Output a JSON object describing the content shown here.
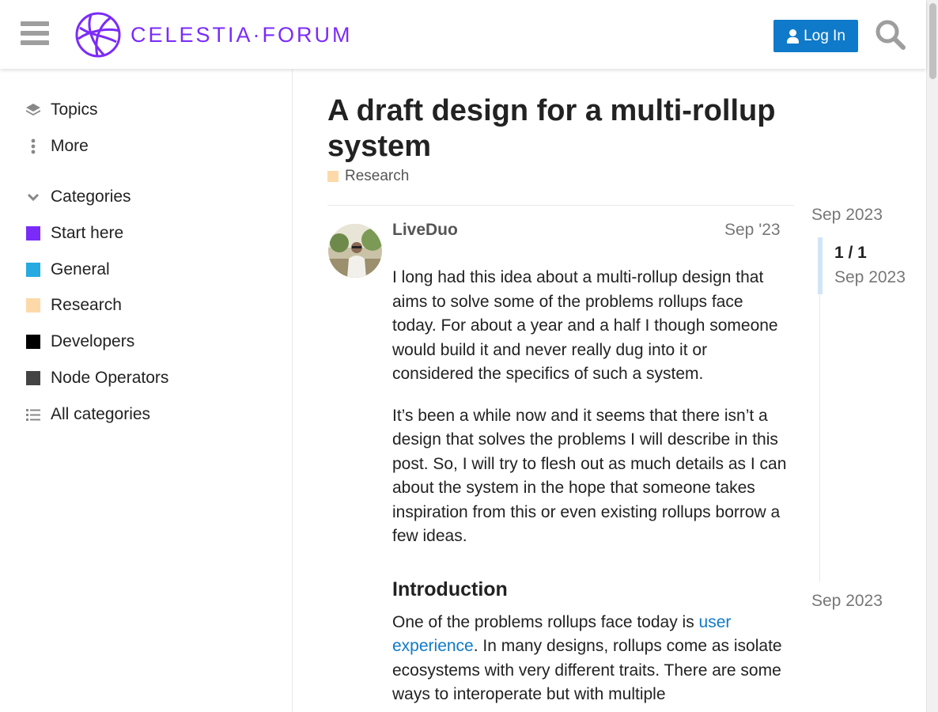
{
  "header": {
    "logo_text": "CELESTIA·FORUM",
    "login_label": "Log In"
  },
  "sidebar": {
    "topics_label": "Topics",
    "more_label": "More",
    "categories_label": "Categories",
    "categories": [
      {
        "label": "Start here",
        "color": "#7b2bf9"
      },
      {
        "label": "General",
        "color": "#25aae1"
      },
      {
        "label": "Research",
        "color": "#fdd9a9"
      },
      {
        "label": "Developers",
        "color": "#000000"
      },
      {
        "label": "Node Operators",
        "color": "#444444"
      }
    ],
    "all_categories_label": "All categories"
  },
  "topic": {
    "title": "A draft design for a multi-rollup system",
    "category": "Research",
    "category_color": "#fdd9a9"
  },
  "post": {
    "author": "LiveDuo",
    "date": "Sep '23",
    "paragraph1": "I long had this idea about a multi-rollup design that aims to solve some of the problems rollups face today. For about a year and a half I though someone would build it and never really dug into it or considered the specifics of such a system.",
    "paragraph2": "It’s been a while now and it seems that there isn’t a design that solves the problems I will describe in this post. So, I will try to flesh out as much details as I can about the system in the hope that someone takes inspiration from this or even existing rollups borrow a few ideas.",
    "heading": "Introduction",
    "paragraph3_before": "One of the problems rollups face today is ",
    "paragraph3_link": "user experience",
    "paragraph3_after": ". In many designs, rollups come as isolate ecosystems with very different traits. There are some ways to interoperate but with multiple"
  },
  "timeline": {
    "start_date": "Sep 2023",
    "position": "1 / 1",
    "position_date": "Sep 2023",
    "end_date": "Sep 2023"
  },
  "colors": {
    "brand": "#7b2bf9",
    "primary": "#0f7ac9"
  }
}
